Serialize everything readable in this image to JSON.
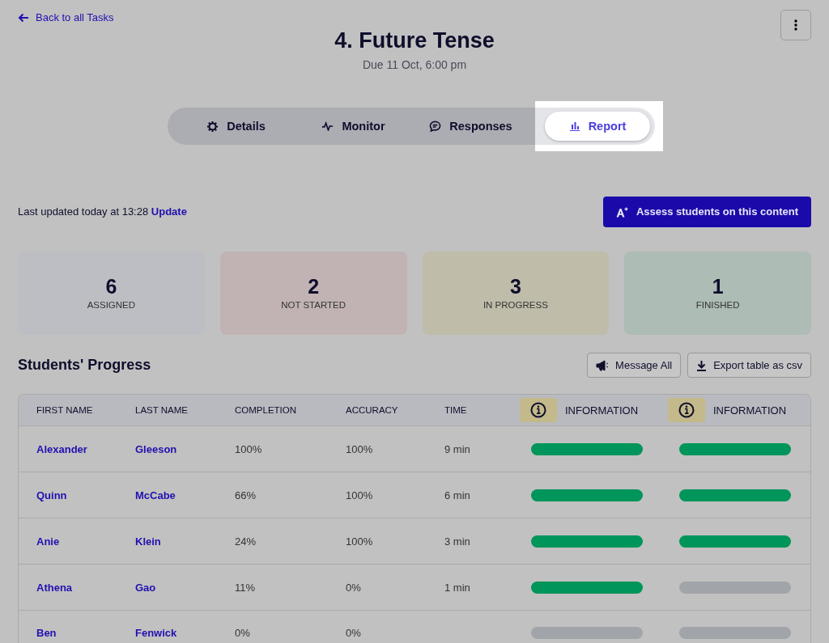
{
  "back_link": "Back to all Tasks",
  "title": "4. Future Tense",
  "due": "Due 11 Oct, 6:00 pm",
  "tabs": [
    {
      "label": "Details",
      "kind": "gear",
      "selected": false
    },
    {
      "label": "Monitor",
      "kind": "pulse",
      "selected": false
    },
    {
      "label": "Responses",
      "kind": "chat",
      "selected": false
    },
    {
      "label": "Report",
      "kind": "chart",
      "selected": true
    }
  ],
  "updated": {
    "text": "Last updated today at 13:28",
    "link": "Update"
  },
  "assess_button": "Assess students on this content",
  "stats": [
    {
      "value": "6",
      "label": "ASSIGNED",
      "color": "#bcbec3"
    },
    {
      "value": "2",
      "label": "NOT STARTED",
      "color": "#c1b3b3"
    },
    {
      "value": "3",
      "label": "IN PROGRESS",
      "color": "#bfbca9"
    },
    {
      "value": "1",
      "label": "FINISHED",
      "color": "#adbcb4"
    }
  ],
  "section_title": "Students' Progress",
  "actions": [
    {
      "label": "Message All",
      "kind": "megaphone"
    },
    {
      "label": "Export table as csv",
      "kind": "download"
    }
  ],
  "table": {
    "columns": [
      "FIRST NAME",
      "LAST NAME",
      "COMPLETION",
      "ACCURACY",
      "TIME"
    ],
    "info_columns": [
      "INFORMATION",
      "INFORMATION"
    ],
    "rows": [
      {
        "first": "Alexander",
        "last": "Gleeson",
        "completion": "100%",
        "accuracy": "100%",
        "time": "9 min",
        "info": [
          {
            "done": true
          },
          {
            "done": true
          }
        ]
      },
      {
        "first": "Quinn",
        "last": "McCabe",
        "completion": "66%",
        "accuracy": "100%",
        "time": "6 min",
        "info": [
          {
            "done": true
          },
          {
            "done": true
          }
        ]
      },
      {
        "first": "Anie",
        "last": "Klein",
        "completion": "24%",
        "accuracy": "100%",
        "time": "3 min",
        "info": [
          {
            "done": true
          },
          {
            "done": true
          }
        ]
      },
      {
        "first": "Athena",
        "last": "Gao",
        "completion": "11%",
        "accuracy": "0%",
        "time": "1 min",
        "info": [
          {
            "done": true
          },
          {
            "done": false
          }
        ]
      },
      {
        "first": "Ben",
        "last": "Fenwick",
        "completion": "0%",
        "accuracy": "0%",
        "info": [
          {
            "done": false
          },
          {
            "done": false
          }
        ]
      }
    ]
  }
}
